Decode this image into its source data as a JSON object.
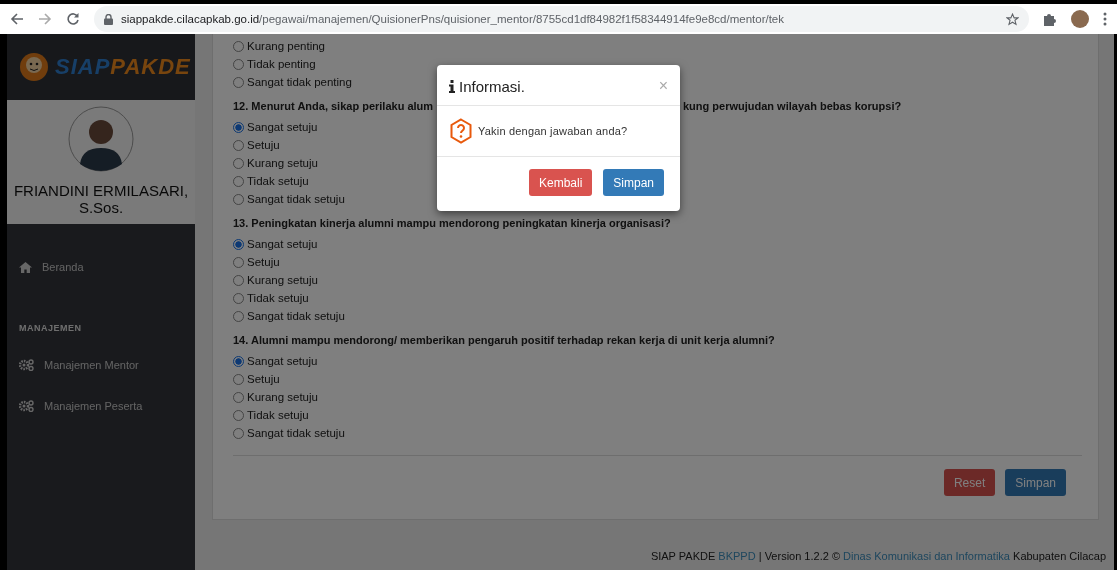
{
  "browser": {
    "url_host": "siappakde.cilacapkab.go.id",
    "url_path": "/pegawai/manajemen/QuisionerPns/quisioner_mentor/8755cd1df84982f1f58344914fe9e8cd/mentor/tek"
  },
  "sidebar": {
    "logo_parts": [
      "SIAP",
      "PAKDE"
    ],
    "user_name": "FRIANDINI ERMILASARI, S.Sos.",
    "nav": [
      {
        "kind": "home",
        "label": "Beranda"
      },
      {
        "kind": "section",
        "label": "MANAJEMEN"
      },
      {
        "kind": "cogs",
        "label": "Manajemen Mentor"
      },
      {
        "kind": "cogs",
        "label": "Manajemen Peserta"
      }
    ]
  },
  "questions": [
    {
      "options": [
        {
          "label": "Kurang penting",
          "selected": false
        },
        {
          "label": "Tidak penting",
          "selected": false
        },
        {
          "label": "Sangat tidak penting",
          "selected": false
        }
      ]
    },
    {
      "title_parts": [
        "12. Menurut Anda, sikap perilaku alum",
        "kung perwujudan wilayah bebas korupsi?"
      ],
      "options": [
        {
          "label": "Sangat setuju",
          "selected": true
        },
        {
          "label": "Setuju",
          "selected": false
        },
        {
          "label": "Kurang setuju",
          "selected": false
        },
        {
          "label": "Tidak setuju",
          "selected": false
        },
        {
          "label": "Sangat tidak setuju",
          "selected": false
        }
      ]
    },
    {
      "title_parts": [
        "13. Peningkatan kinerja alumni mampu mendorong peningkatan kinerja organisasi?"
      ],
      "options": [
        {
          "label": "Sangat setuju",
          "selected": true
        },
        {
          "label": "Setuju",
          "selected": false
        },
        {
          "label": "Kurang setuju",
          "selected": false
        },
        {
          "label": "Tidak setuju",
          "selected": false
        },
        {
          "label": "Sangat tidak setuju",
          "selected": false
        }
      ]
    },
    {
      "title_parts": [
        "14. Alumni mampu mendorong/ memberikan pengaruh positif terhadap rekan kerja di unit kerja alumni?"
      ],
      "options": [
        {
          "label": "Sangat setuju",
          "selected": true
        },
        {
          "label": "Setuju",
          "selected": false
        },
        {
          "label": "Kurang setuju",
          "selected": false
        },
        {
          "label": "Tidak setuju",
          "selected": false
        },
        {
          "label": "Sangat tidak setuju",
          "selected": false
        }
      ]
    }
  ],
  "form_buttons": [
    {
      "kind": "danger",
      "label": "Reset"
    },
    {
      "kind": "primary",
      "label": "Simpan"
    }
  ],
  "footer": [
    {
      "kind": "plain",
      "text": "SIAP PAKDE "
    },
    {
      "kind": "link",
      "text": "BKPPD"
    },
    {
      "kind": "plain",
      "text": " | Version 1.2.2 © "
    },
    {
      "kind": "link",
      "text": "Dinas Komunikasi dan Informatika"
    },
    {
      "kind": "plain",
      "text": " Kabupaten Cilacap"
    }
  ],
  "modal": {
    "title": "Informasi.",
    "close": "×",
    "message": "Yakin dengan jawaban anda?",
    "buttons": [
      {
        "kind": "danger",
        "label": "Kembali"
      },
      {
        "kind": "primary",
        "label": "Simpan"
      }
    ]
  }
}
